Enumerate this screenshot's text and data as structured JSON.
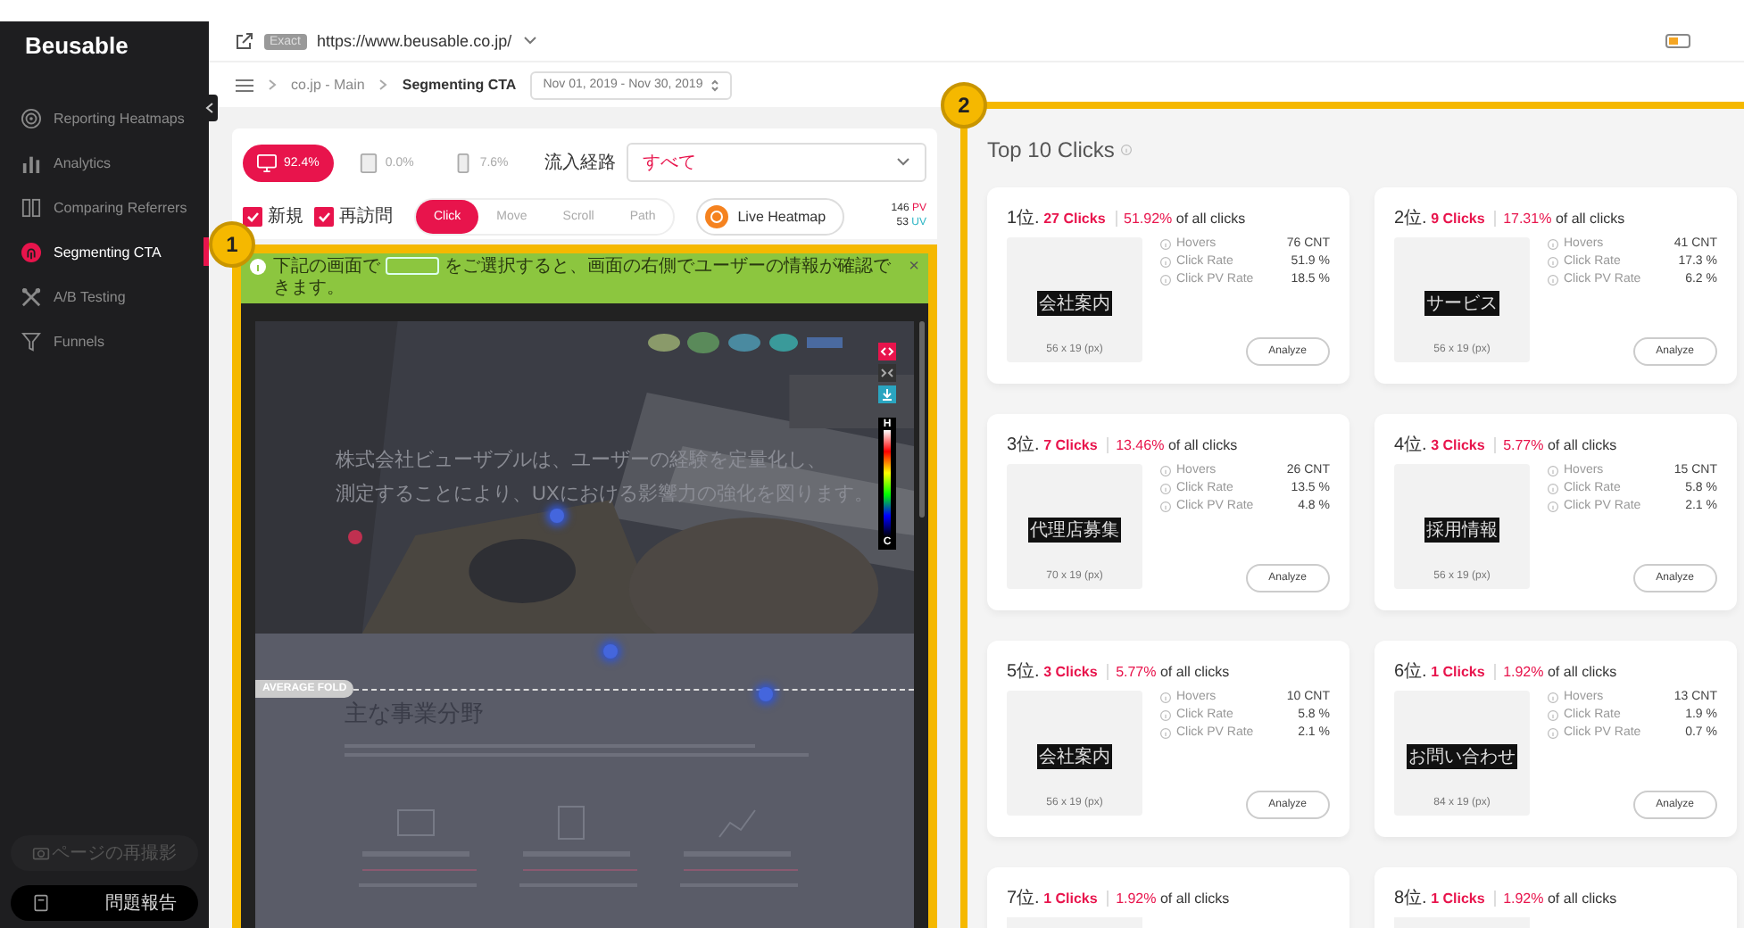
{
  "sidebar": {
    "logo": "Beusable",
    "items": [
      {
        "kind": "target",
        "label": "Reporting Heatmaps",
        "selected": false
      },
      {
        "kind": "bars",
        "label": "Analytics",
        "selected": false
      },
      {
        "kind": "columns",
        "label": "Comparing Referrers",
        "selected": false
      },
      {
        "kind": "fingerprint",
        "label": "Segmenting CTA",
        "selected": true
      },
      {
        "kind": "ab",
        "label": "A/B Testing",
        "selected": false
      },
      {
        "kind": "funnel",
        "label": "Funnels",
        "selected": false
      }
    ],
    "buttons": [
      {
        "kind": "camera",
        "label": "ページの再撮影",
        "disabled": true
      },
      {
        "kind": "report",
        "label": "問題報告",
        "disabled": false
      }
    ]
  },
  "header": {
    "match": "Exact",
    "url": "https://www.beusable.co.jp/"
  },
  "breadcrumb": {
    "items": [
      "co.jp - Main",
      "Segmenting CTA"
    ],
    "date_range": "Nov 01, 2019 - Nov 30, 2019"
  },
  "filters": {
    "devices": [
      {
        "kind": "desktop",
        "value": "92.4%",
        "selected": true
      },
      {
        "kind": "tablet",
        "value": "0.0%",
        "selected": false
      },
      {
        "kind": "mobile",
        "value": "7.6%",
        "selected": false
      }
    ],
    "referrer_label": "流入経路",
    "referrer_value": "すべて",
    "visitor_types": [
      {
        "label": "新規",
        "checked": true
      },
      {
        "label": "再訪問",
        "checked": true
      }
    ],
    "modes": [
      {
        "label": "Click",
        "selected": true
      },
      {
        "label": "Move",
        "selected": false
      },
      {
        "label": "Scroll",
        "selected": false
      },
      {
        "label": "Path",
        "selected": false
      }
    ],
    "live_button": "Live Heatmap",
    "pv_count": "146",
    "pv_unit": "PV",
    "uv_count": "53",
    "uv_unit": "UV"
  },
  "callouts": [
    "1",
    "2"
  ],
  "heatmap": {
    "banner_before": "下記の画面で",
    "banner_after": "をご選択すると、画面の右側でユーザーの情報が確認できます。",
    "banner_close": "×",
    "hero_lines": [
      "株式会社ビューザブルは、ユーザーの経験を定量化し、",
      "測定することにより、UXにおける影響力の強化を図ります。"
    ],
    "fold_label": "AVERAGE FOLD",
    "section_heading": "主な事業分野",
    "legend_high": "H",
    "legend_low": "C"
  },
  "top_clicks": {
    "title": "Top 10 Clicks",
    "cards": [
      {
        "rank": "1位.",
        "clicks": "27 Clicks",
        "percent": "51.92%",
        "suffix": "of all clicks",
        "element": "会社案内",
        "size": "56 x 19 (px)",
        "stats": [
          {
            "label": "Hovers",
            "value": "76 CNT"
          },
          {
            "label": "Click Rate",
            "value": "51.9 %"
          },
          {
            "label": "Click PV Rate",
            "value": "18.5 %"
          }
        ],
        "button": "Analyze"
      },
      {
        "rank": "2位.",
        "clicks": "9 Clicks",
        "percent": "17.31%",
        "suffix": "of all clicks",
        "element": "サービス",
        "size": "56 x 19 (px)",
        "stats": [
          {
            "label": "Hovers",
            "value": "41 CNT"
          },
          {
            "label": "Click Rate",
            "value": "17.3 %"
          },
          {
            "label": "Click PV Rate",
            "value": "6.2 %"
          }
        ],
        "button": "Analyze"
      },
      {
        "rank": "3位.",
        "clicks": "7 Clicks",
        "percent": "13.46%",
        "suffix": "of all clicks",
        "element": "代理店募集",
        "size": "70 x 19 (px)",
        "stats": [
          {
            "label": "Hovers",
            "value": "26 CNT"
          },
          {
            "label": "Click Rate",
            "value": "13.5 %"
          },
          {
            "label": "Click PV Rate",
            "value": "4.8 %"
          }
        ],
        "button": "Analyze"
      },
      {
        "rank": "4位.",
        "clicks": "3 Clicks",
        "percent": "5.77%",
        "suffix": "of all clicks",
        "element": "採用情報",
        "size": "56 x 19 (px)",
        "stats": [
          {
            "label": "Hovers",
            "value": "15 CNT"
          },
          {
            "label": "Click Rate",
            "value": "5.8 %"
          },
          {
            "label": "Click PV Rate",
            "value": "2.1 %"
          }
        ],
        "button": "Analyze"
      },
      {
        "rank": "5位.",
        "clicks": "3 Clicks",
        "percent": "5.77%",
        "suffix": "of all clicks",
        "element": "会社案内",
        "size": "56 x 19 (px)",
        "stats": [
          {
            "label": "Hovers",
            "value": "10 CNT"
          },
          {
            "label": "Click Rate",
            "value": "5.8 %"
          },
          {
            "label": "Click PV Rate",
            "value": "2.1 %"
          }
        ],
        "button": "Analyze"
      },
      {
        "rank": "6位.",
        "clicks": "1 Clicks",
        "percent": "1.92%",
        "suffix": "of all clicks",
        "element": "お問い合わせ",
        "size": "84 x 19 (px)",
        "stats": [
          {
            "label": "Hovers",
            "value": "13 CNT"
          },
          {
            "label": "Click Rate",
            "value": "1.9 %"
          },
          {
            "label": "Click PV Rate",
            "value": "0.7 %"
          }
        ],
        "button": "Analyze"
      },
      {
        "rank": "7位.",
        "clicks": "1 Clicks",
        "percent": "1.92%",
        "suffix": "of all clicks"
      },
      {
        "rank": "8位.",
        "clicks": "1 Clicks",
        "percent": "1.92%",
        "suffix": "of all clicks"
      }
    ]
  }
}
